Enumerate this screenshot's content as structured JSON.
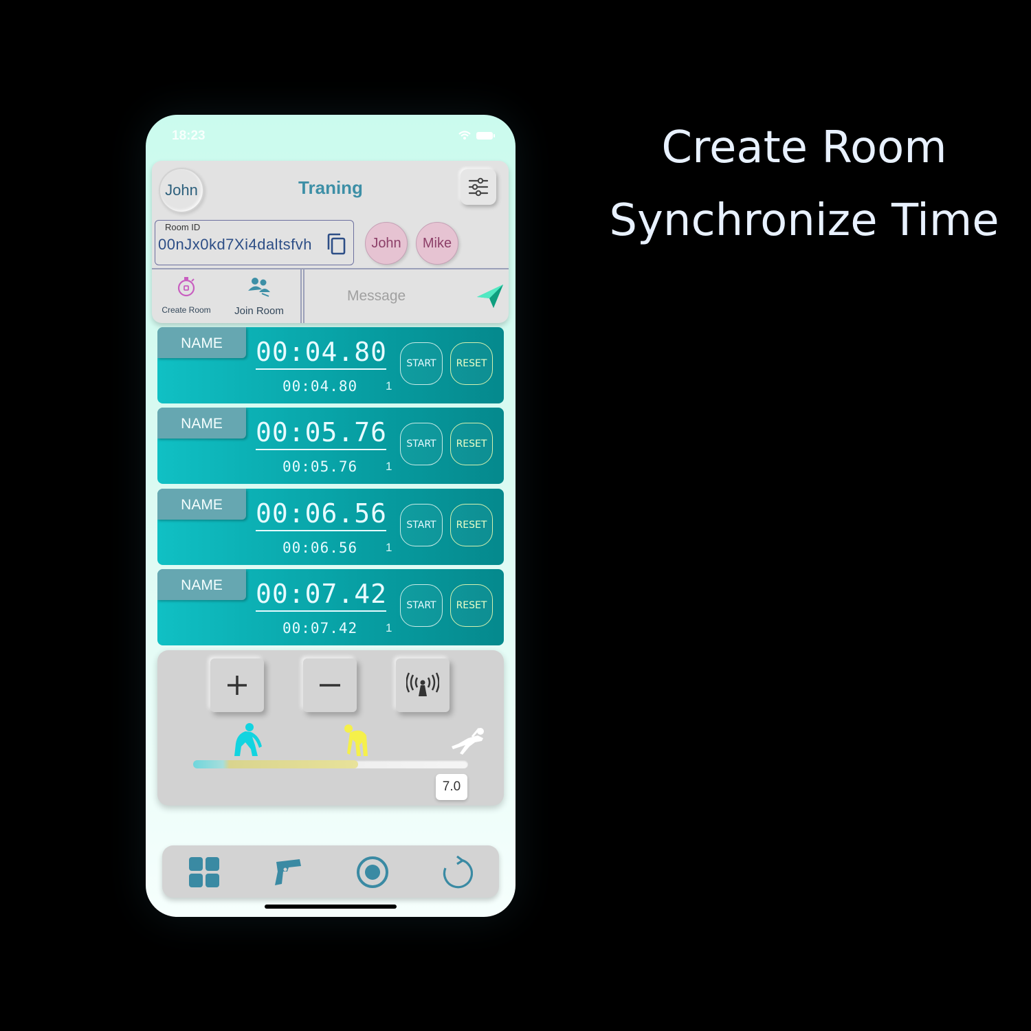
{
  "caption": {
    "line1": "Create Room",
    "line2": "Synchronize Time"
  },
  "status_bar": {
    "time": "18:23"
  },
  "header": {
    "user_name": "John",
    "title": "Traning",
    "settings_icon": "sliders-icon"
  },
  "room": {
    "label": "Room ID",
    "id": "00nJx0kd7Xi4daltsfvh",
    "members": [
      "John",
      "Mike"
    ]
  },
  "tabs": {
    "create_room": "Create Room",
    "join_room": "Join Room"
  },
  "message": {
    "placeholder": "Message"
  },
  "timers": [
    {
      "name": "NAME",
      "main": "00:04.80",
      "sub": "00:04.80",
      "count": "1",
      "start": "START",
      "reset": "RESET"
    },
    {
      "name": "NAME",
      "main": "00:05.76",
      "sub": "00:05.76",
      "count": "1",
      "start": "START",
      "reset": "RESET"
    },
    {
      "name": "NAME",
      "main": "00:06.56",
      "sub": "00:06.56",
      "count": "1",
      "start": "START",
      "reset": "RESET"
    },
    {
      "name": "NAME",
      "main": "00:07.42",
      "sub": "00:07.42",
      "count": "1",
      "start": "START",
      "reset": "RESET"
    }
  ],
  "controls": {
    "slider_value": "7.0",
    "slider_fill_fraction": 0.6,
    "colors": {
      "runner_1": "#12d4e0",
      "runner_2": "#f5f04a",
      "runner_3": "#ffffff"
    }
  },
  "nav": [
    "grid-icon",
    "starter-pistol-icon",
    "record-icon",
    "refresh-icon"
  ],
  "colors": {
    "accent": "#3d8fa6",
    "timer_bg": "#079ea2"
  }
}
